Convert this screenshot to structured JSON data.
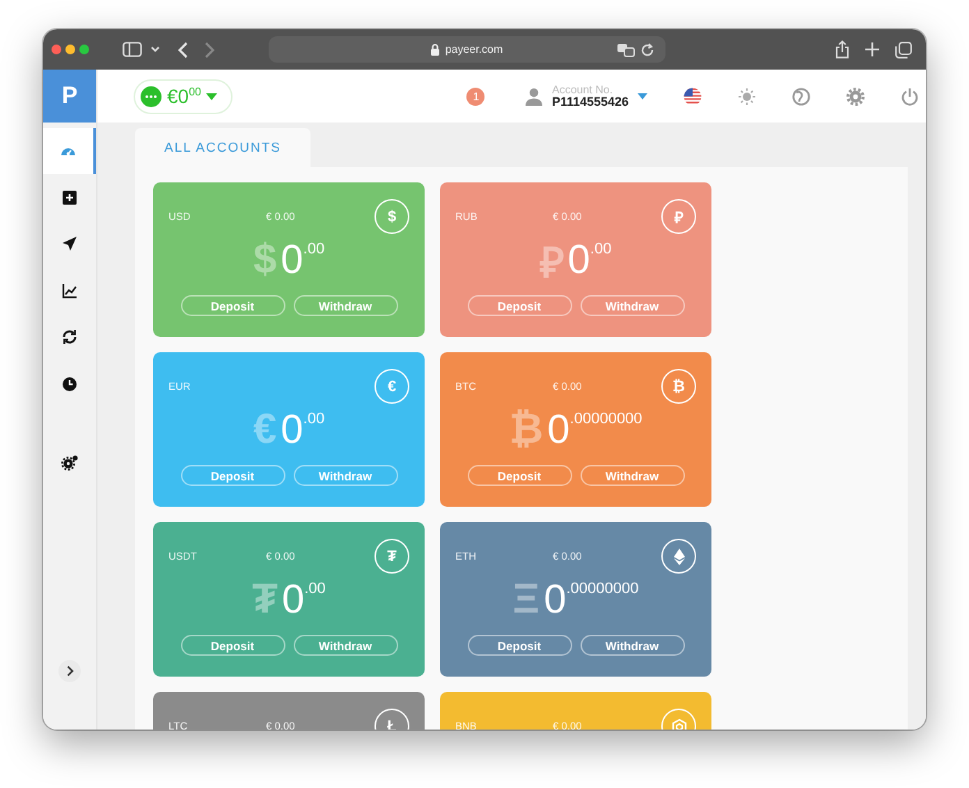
{
  "browser": {
    "url": "payeer.com"
  },
  "logo": {
    "text": "P"
  },
  "header": {
    "balance": "€0$^{00}$",
    "notifications": "1",
    "account": {
      "label": "Account No.",
      "number": "P1114555426"
    }
  },
  "sidebar": {
    "items": [
      {
        "kind": "dashboard",
        "selected": true
      },
      {
        "kind": "add",
        "selected": false
      },
      {
        "kind": "send",
        "selected": false
      },
      {
        "kind": "chart",
        "selected": false
      },
      {
        "kind": "exchange",
        "selected": false
      },
      {
        "kind": "history",
        "selected": false
      }
    ],
    "tools": [
      {
        "kind": "settings",
        "selected": false
      }
    ]
  },
  "tabs": [
    {
      "label": "ALL ACCOUNTS",
      "selected": true
    }
  ],
  "accounts": [
    {
      "code": "USD",
      "eur_value": "€ 0.00",
      "icon": {
        "kind": "glyph",
        "glyph": "$"
      },
      "symbol": "$",
      "amount": "0$^{.00}$",
      "color": "#76c46f",
      "buttons": [
        "Deposit",
        "Withdraw"
      ]
    },
    {
      "code": "RUB",
      "eur_value": "€ 0.00",
      "icon": {
        "kind": "glyph",
        "glyph": "₽"
      },
      "symbol": "₽",
      "amount": "0$^{.00}$",
      "color": "#ee937f",
      "buttons": [
        "Deposit",
        "Withdraw"
      ]
    },
    {
      "code": "EUR",
      "icon": {
        "kind": "glyph",
        "glyph": "€"
      },
      "symbol": "€",
      "amount": "0$^{.00}$",
      "color": "#3ebdf0",
      "buttons": [
        "Deposit",
        "Withdraw"
      ]
    },
    {
      "code": "BTC",
      "eur_value": "€ 0.00",
      "icon": {
        "kind": "glyph",
        "glyph": "₿"
      },
      "symbol": "₿",
      "amount": "0$^{.00000000}$",
      "color": "#f28b4b",
      "buttons": [
        "Deposit",
        "Withdraw"
      ]
    },
    {
      "code": "USDT",
      "eur_value": "€ 0.00",
      "icon": {
        "kind": "glyph",
        "glyph": "₮"
      },
      "symbol": "₮",
      "amount": "0$^{.00}$",
      "color": "#4bb091",
      "buttons": [
        "Deposit",
        "Withdraw"
      ]
    },
    {
      "code": "ETH",
      "eur_value": "€ 0.00",
      "icon": {
        "kind": "eth"
      },
      "symbol": "Ξ",
      "amount": "0$^{.00000000}$",
      "color": "#6689a6",
      "buttons": [
        "Deposit",
        "Withdraw"
      ]
    },
    {
      "code": "LTC",
      "eur_value": "€ 0.00",
      "icon": {
        "kind": "glyph",
        "glyph": "Ł"
      },
      "color": "#8b8b8b"
    },
    {
      "code": "BNB",
      "eur_value": "€ 0.00",
      "icon": {
        "kind": "bnb"
      },
      "color": "#f3bb30"
    }
  ]
}
